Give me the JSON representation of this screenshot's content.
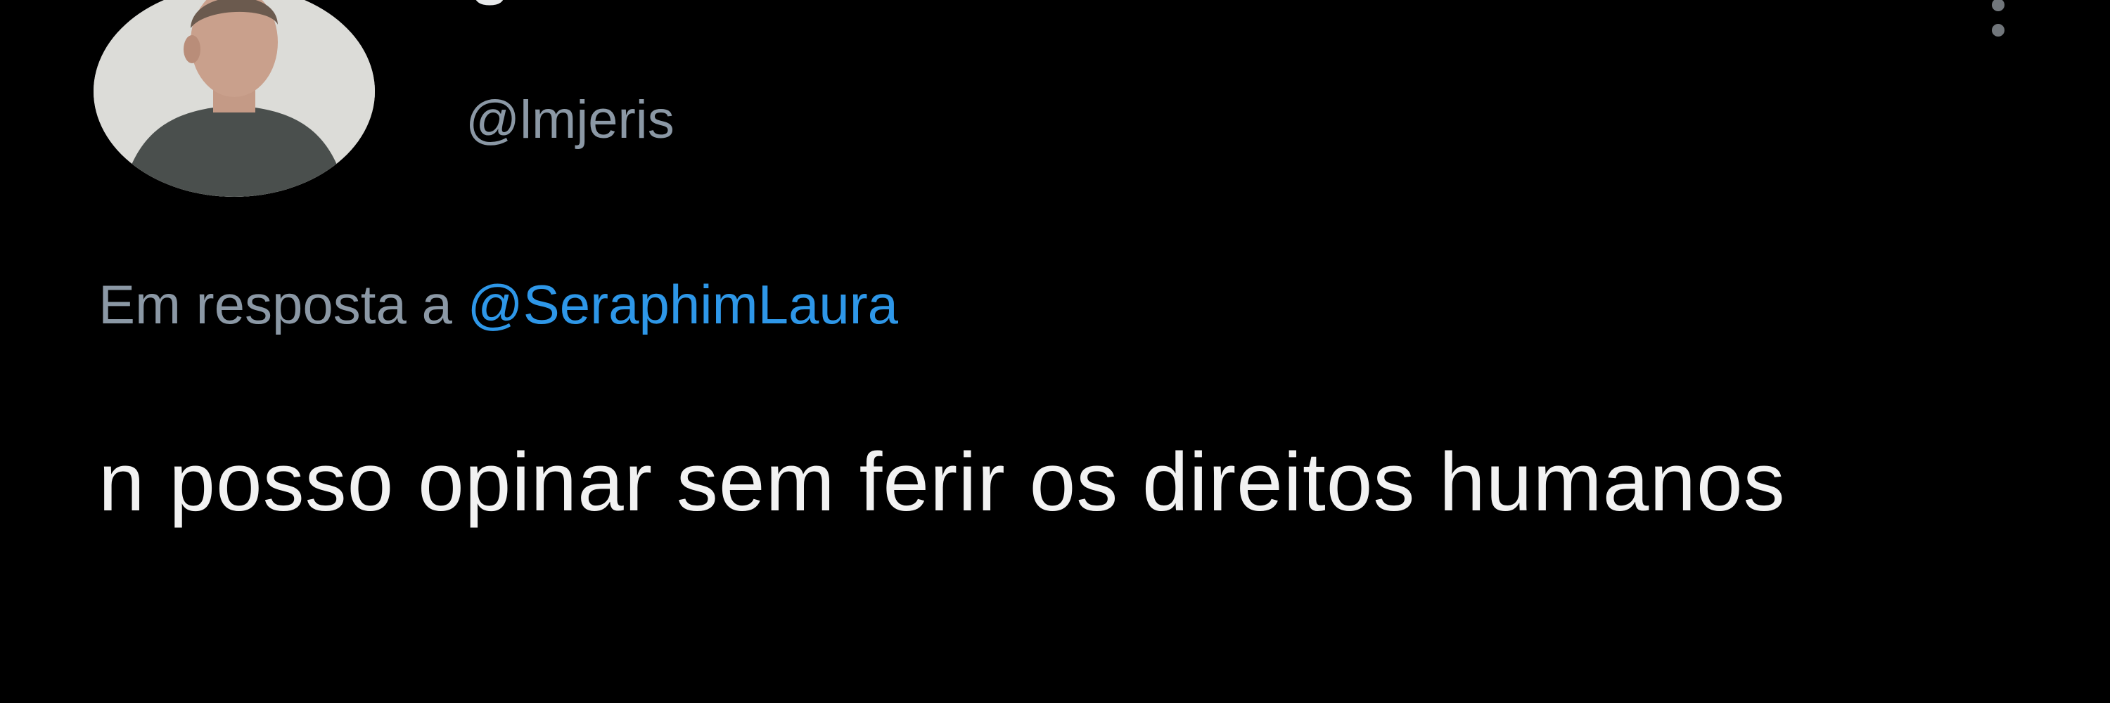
{
  "tweet": {
    "display_name": "S",
    "handle": "@lmjeris",
    "reply_context": {
      "prefix": "Em resposta a",
      "mention": "@SeraphimLaura"
    },
    "text": "n posso opinar sem ferir os direitos humanos",
    "more_icon": "more-vertical-icon",
    "colors": {
      "background": "#000000",
      "text": "#e7e9ea",
      "secondary": "#8b98a5",
      "mention": "#2e97e8"
    }
  }
}
